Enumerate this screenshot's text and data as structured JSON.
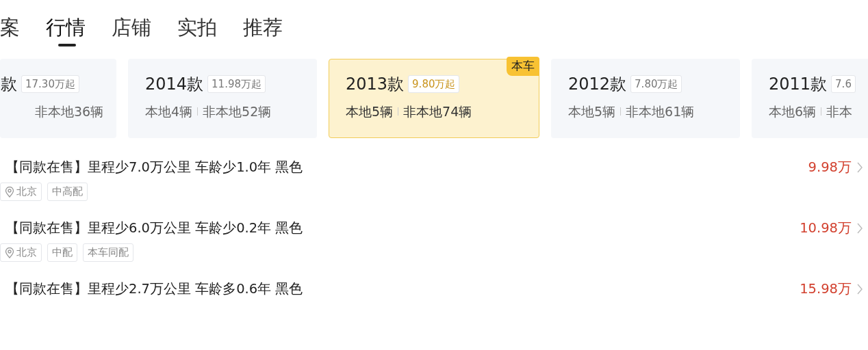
{
  "tabs": [
    {
      "label": "案",
      "selected": false
    },
    {
      "label": "行情",
      "selected": true
    },
    {
      "label": "店铺",
      "selected": false
    },
    {
      "label": "实拍",
      "selected": false
    },
    {
      "label": "推荐",
      "selected": false
    }
  ],
  "model_years": [
    {
      "year": "款",
      "price": "17.30万起",
      "nonlocal": "非本地36辆",
      "selected": false
    },
    {
      "year": "2014款",
      "price": "11.98万起",
      "local": "本地4辆",
      "nonlocal": "非本地52辆",
      "selected": false
    },
    {
      "year": "2013款",
      "price": "9.80万起",
      "local": "本地5辆",
      "nonlocal": "非本地74辆",
      "selected": true,
      "badge": "本车"
    },
    {
      "year": "2012款",
      "price": "7.80万起",
      "local": "本地5辆",
      "nonlocal": "非本地61辆",
      "selected": false
    },
    {
      "year": "2011款",
      "price": "7.6",
      "local": "本地6辆",
      "nonlocal": "非本",
      "selected": false
    }
  ],
  "listings": [
    {
      "title": "【同款在售】里程少7.0万公里 车龄少1.0年 黑色",
      "location": "北京",
      "tags": [
        "中高配"
      ],
      "price": "9.98万"
    },
    {
      "title": "【同款在售】里程少6.0万公里 车龄少0.2年 黑色",
      "location": "北京",
      "tags": [
        "中配",
        "本车同配"
      ],
      "price": "10.98万"
    },
    {
      "title": "【同款在售】里程少2.7万公里 车龄多0.6年 黑色",
      "price": "15.98万"
    }
  ]
}
